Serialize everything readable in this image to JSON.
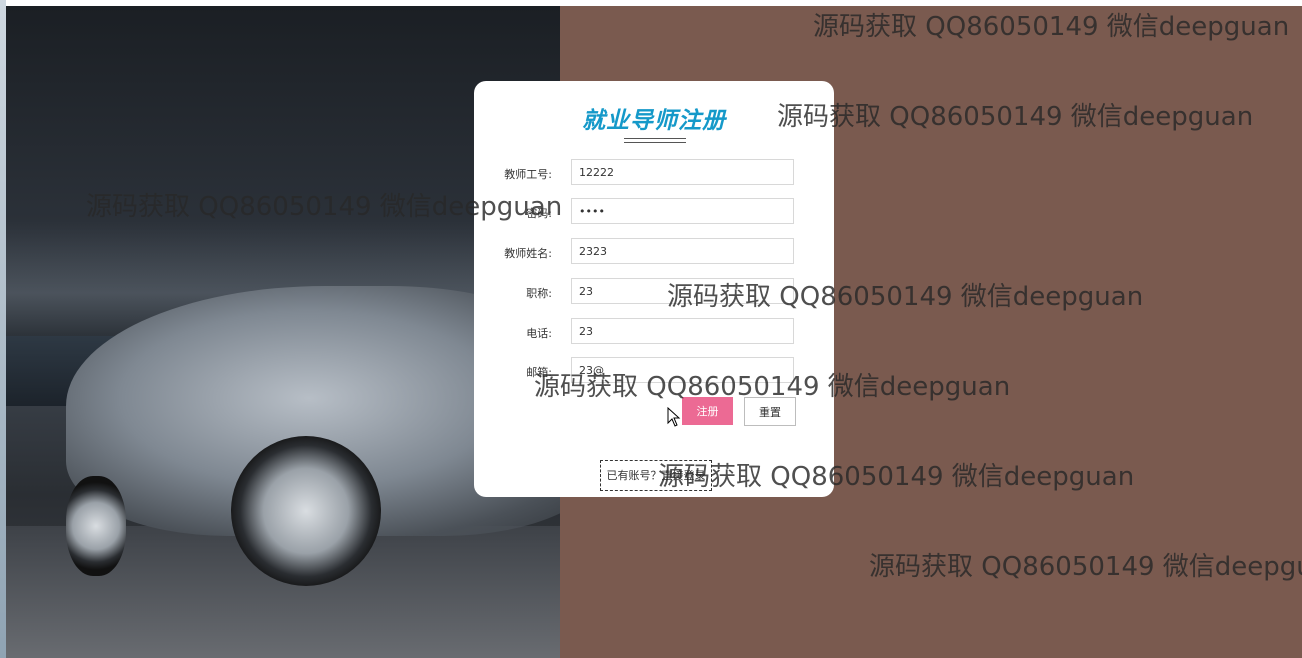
{
  "form": {
    "title": "就业导师注册",
    "fields": [
      {
        "label": "教师工号:",
        "value": "12222",
        "type": "text"
      },
      {
        "label": "密码:",
        "value": "••••",
        "type": "text"
      },
      {
        "label": "教师姓名:",
        "value": "2323",
        "type": "text"
      },
      {
        "label": "职称:",
        "value": "23",
        "type": "text"
      },
      {
        "label": "电话:",
        "value": "23",
        "type": "text"
      },
      {
        "label": "邮箱:",
        "value": "23@",
        "type": "text"
      }
    ],
    "register_label": "注册",
    "reset_label": "重置",
    "login_link_label": "已有账号？直接登录"
  },
  "watermark": {
    "text": "源码获取 QQ86050149 微信deepguan"
  },
  "colors": {
    "title": "#1599c9",
    "register_button": "#ec6a94",
    "page_background": "#7a5a4f"
  },
  "icons": [
    "mouse-cursor-icon"
  ]
}
